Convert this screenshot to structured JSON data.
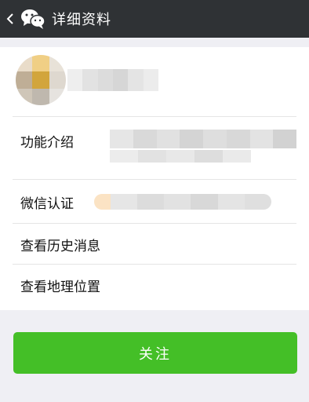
{
  "header": {
    "title": "详细资料",
    "back_icon": "chevron-left-icon",
    "app_icon": "wechat-icon"
  },
  "rows": {
    "intro_label": "功能介绍",
    "verify_label": "微信认证",
    "history_label": "查看历史消息",
    "location_label": "查看地理位置"
  },
  "actions": {
    "follow_label": "关注"
  },
  "colors": {
    "topbar": "#2f3235",
    "background": "#efeff4",
    "accent_green": "#44bf27"
  }
}
